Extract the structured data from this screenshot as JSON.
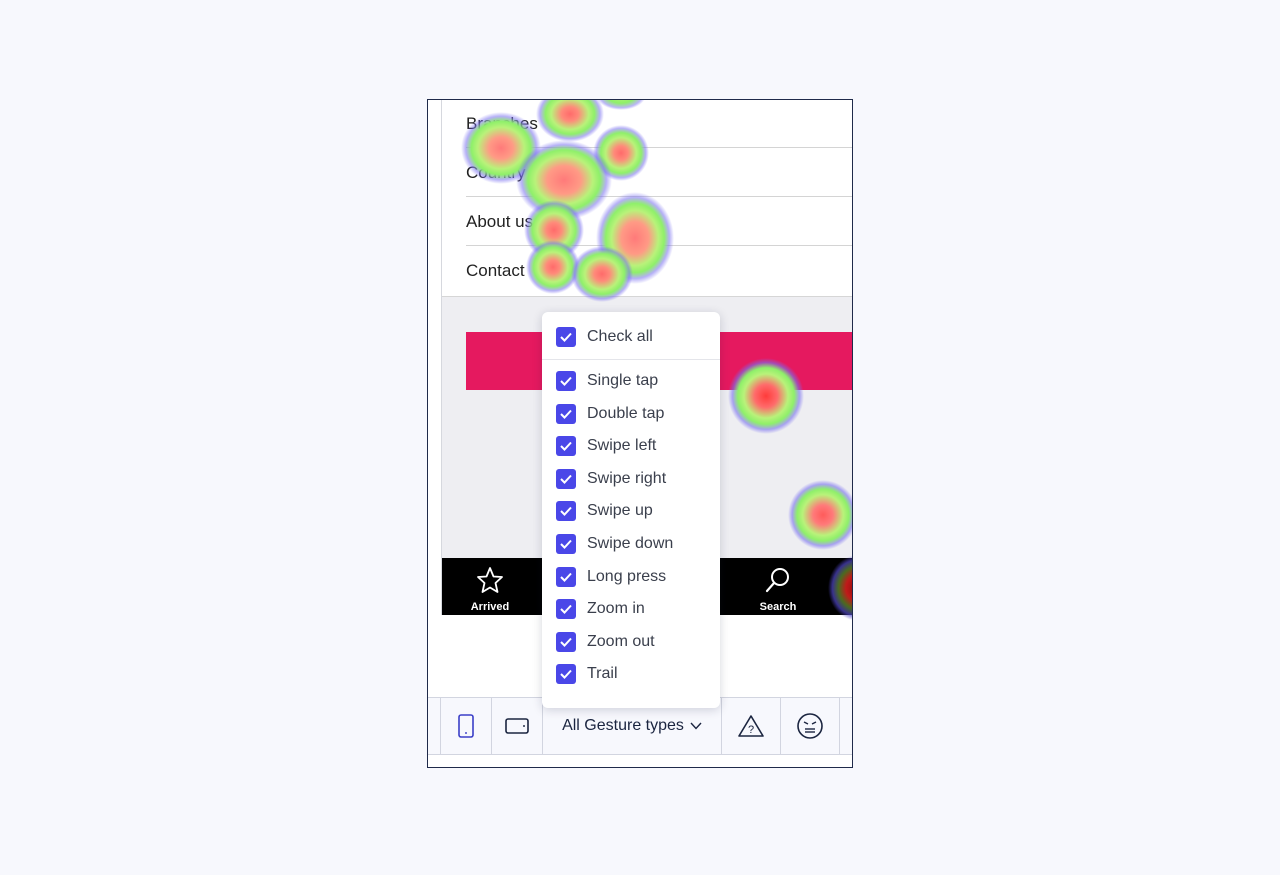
{
  "menu": {
    "items": [
      {
        "label": "Branches"
      },
      {
        "label": "Country"
      },
      {
        "label": "About us"
      },
      {
        "label": "Contact"
      }
    ]
  },
  "tabbar": {
    "items": [
      {
        "label": "Arrived",
        "icon": "star-icon"
      },
      {
        "label": "Search",
        "icon": "search-icon"
      }
    ]
  },
  "toolbar": {
    "phone_portrait": "phone-portrait-icon",
    "phone_landscape": "phone-landscape-icon",
    "gesture_label": "All Gesture types",
    "warning": "warning-icon",
    "frustrated": "frustrated-face-icon"
  },
  "dropdown": {
    "check_all": "Check all",
    "options": [
      {
        "label": "Single tap",
        "checked": true
      },
      {
        "label": "Double tap",
        "checked": true
      },
      {
        "label": "Swipe left",
        "checked": true
      },
      {
        "label": "Swipe right",
        "checked": true
      },
      {
        "label": "Swipe up",
        "checked": true
      },
      {
        "label": "Swipe down",
        "checked": true
      },
      {
        "label": "Long press",
        "checked": true
      },
      {
        "label": "Zoom in",
        "checked": true
      },
      {
        "label": "Zoom out",
        "checked": true
      },
      {
        "label": "Trail",
        "checked": true
      }
    ]
  },
  "colors": {
    "accent": "#4a47e8",
    "pink_banner": "#e5195f",
    "tabbar": "#000000",
    "heat_hot": "#ff4d4d",
    "heat_mid": "#a8f06a",
    "heat_cool": "#6f6cf0"
  }
}
